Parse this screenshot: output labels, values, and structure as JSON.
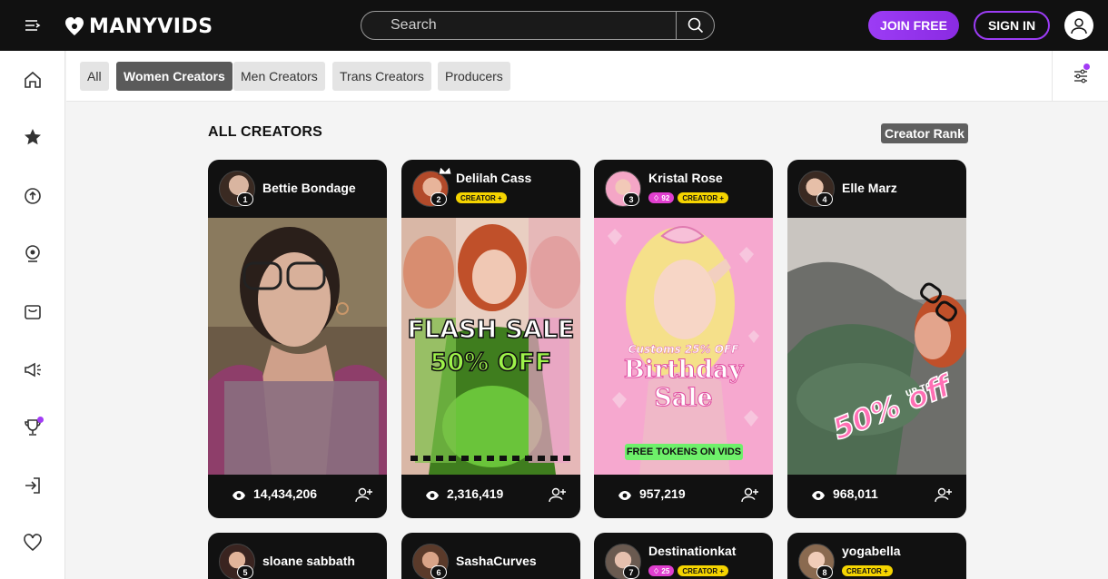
{
  "header": {
    "logo_text": "MANYVIDS",
    "search_placeholder": "Search",
    "join_label": "JOIN FREE",
    "signin_label": "SIGN IN"
  },
  "filters": {
    "chips": [
      "All",
      "Women Creators",
      "Men Creators",
      "Trans Creators",
      "Producers"
    ],
    "active": "Women Creators"
  },
  "section": {
    "title": "ALL CREATORS",
    "sort_label": "Creator Rank"
  },
  "creators": [
    {
      "name": "Bettie Bondage",
      "rank": "1",
      "views": "14,434,206",
      "badges": []
    },
    {
      "name": "Delilah Cass",
      "rank": "2",
      "views": "2,316,419",
      "badges": [
        "CREATOR +"
      ],
      "promo": [
        "FLASH SALE",
        "50% OFF"
      ]
    },
    {
      "name": "Kristal Rose",
      "rank": "3",
      "views": "957,219",
      "tip": "92",
      "badges": [
        "CREATOR +"
      ],
      "promo": [
        "Customs 25% OFF",
        "Birthday Sale",
        "FREE TOKENS ON VIDS"
      ]
    },
    {
      "name": "Elle Marz",
      "rank": "4",
      "views": "968,011",
      "badges": [],
      "promo": [
        "UP TO",
        "50% off"
      ]
    },
    {
      "name": "sloane sabbath",
      "rank": "5",
      "badges": []
    },
    {
      "name": "SashaCurves",
      "rank": "6",
      "badges": []
    },
    {
      "name": "Destinationkat",
      "rank": "7",
      "tip": "25",
      "badges": [
        "CREATOR +"
      ]
    },
    {
      "name": "yogabella",
      "rank": "8",
      "badges": [
        "CREATOR +"
      ]
    }
  ],
  "colors": {
    "topbar": "#111111",
    "accent": "#9c3cf5",
    "creator_badge": "#f5d400",
    "tip_badge": "#e03fcf"
  }
}
